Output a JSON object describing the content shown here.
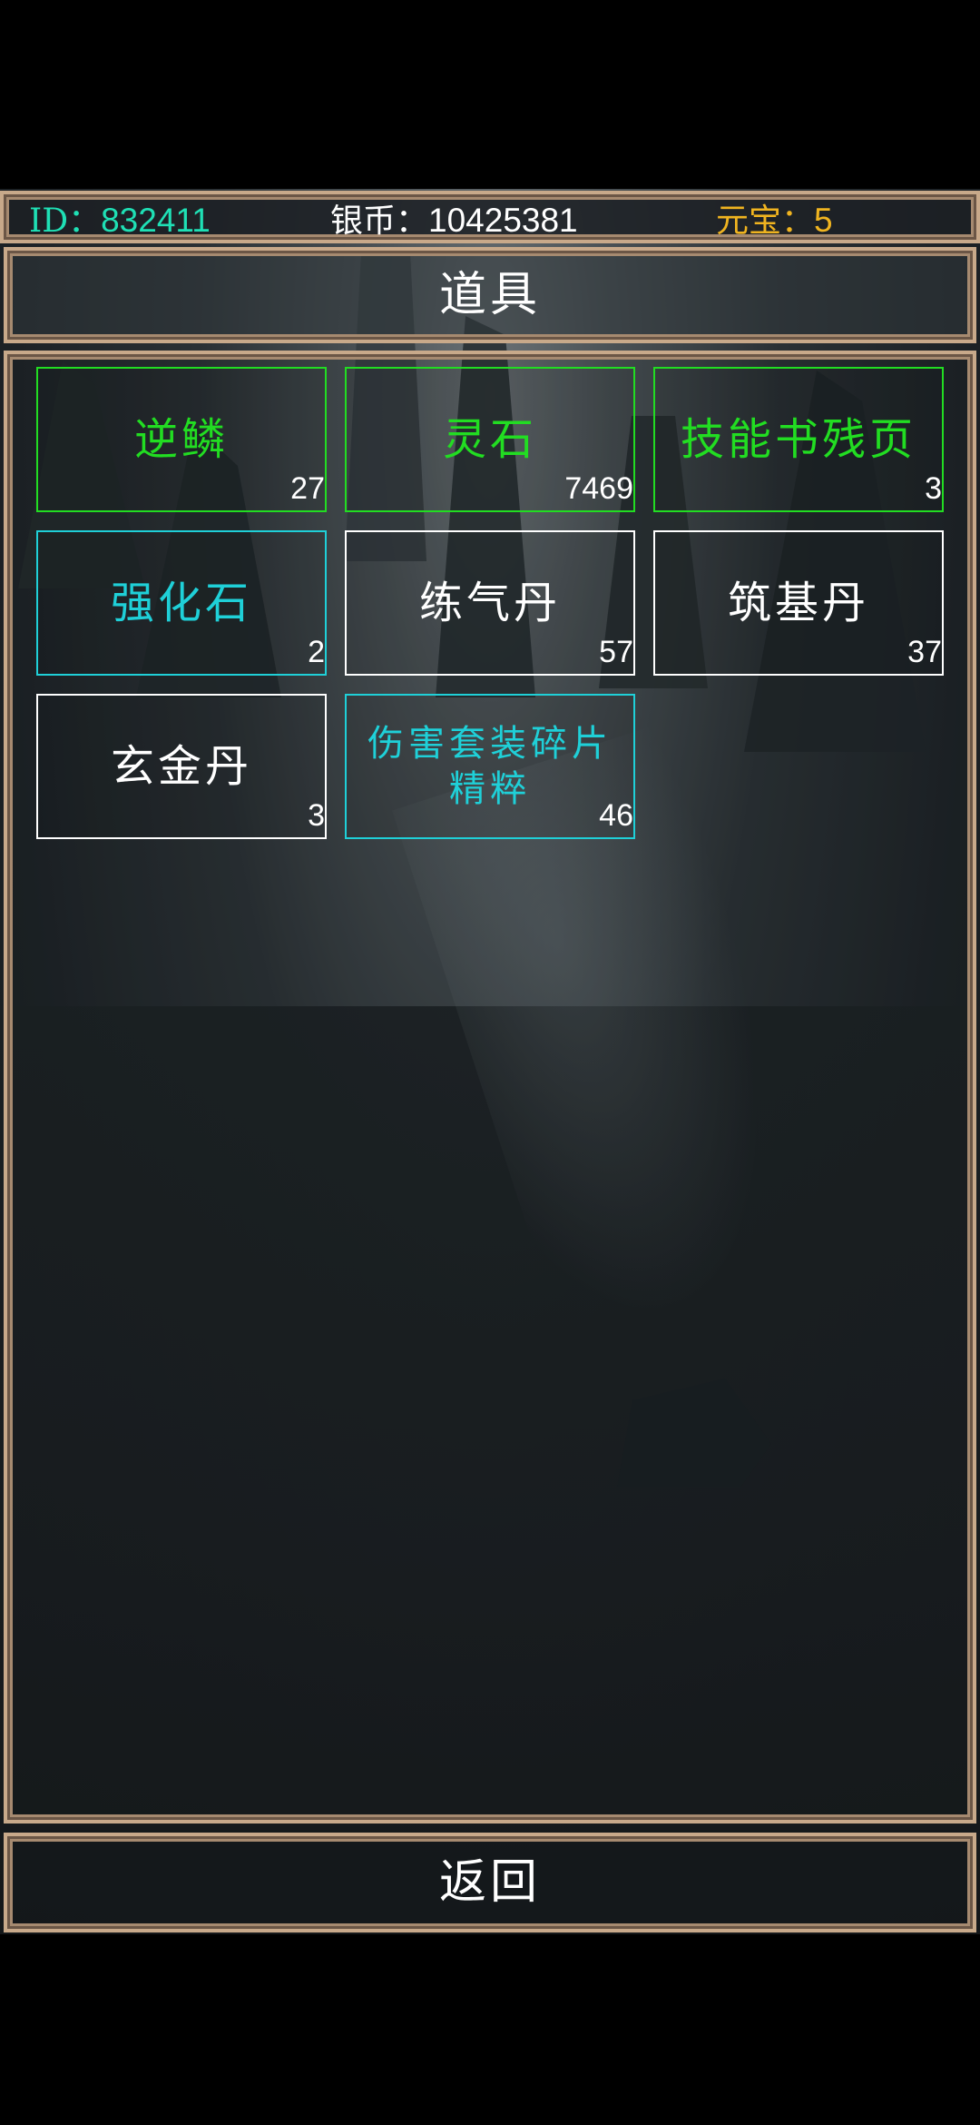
{
  "header": {
    "id_label": "ID：",
    "id_value": "832411",
    "silver_label": "银币：",
    "silver_value": "10425381",
    "yuanbao_label": "元宝：",
    "yuanbao_value": "5"
  },
  "title": "道具",
  "items": [
    {
      "name": "逆鳞",
      "count": "27",
      "color": "#22dd22"
    },
    {
      "name": "灵石",
      "count": "7469",
      "color": "#22dd22"
    },
    {
      "name": "技能书残页",
      "count": "3",
      "color": "#22dd22"
    },
    {
      "name": "强化石",
      "count": "2",
      "color": "#1fd0d8"
    },
    {
      "name": "练气丹",
      "count": "57",
      "color": "#ffffff"
    },
    {
      "name": "筑基丹",
      "count": "37",
      "color": "#ffffff"
    },
    {
      "name": "玄金丹",
      "count": "3",
      "color": "#ffffff"
    },
    {
      "name": "伤害套装碎片精粹",
      "count": "46",
      "color": "#1fd0d8"
    }
  ],
  "back_label": "返回",
  "colors": {
    "rarity_green": "#22dd22",
    "rarity_cyan": "#1fd0d8",
    "rarity_white": "#ffffff",
    "id_color": "#1fe0b5",
    "yuanbao_color": "#f0b420",
    "frame_border": "#c8a98a"
  }
}
